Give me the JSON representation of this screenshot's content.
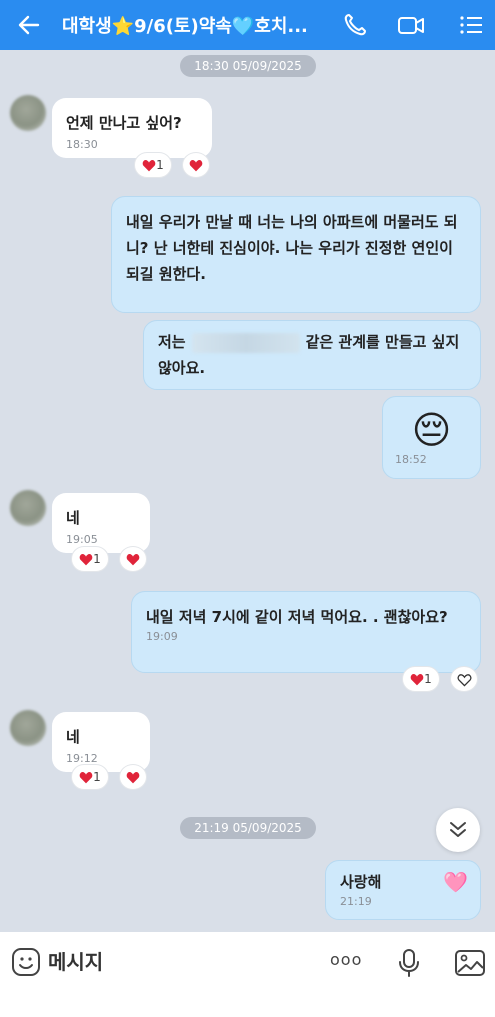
{
  "header": {
    "title": "대학생⭐9/6(토)약속🩵호치...",
    "accent": "#2a8cf0"
  },
  "dates": {
    "first": "18:30 05/09/2025",
    "second": "21:19 05/09/2025"
  },
  "messages": [
    {
      "side": "in",
      "text": "언제 만나고 싶어?",
      "time": "18:30",
      "reaction_count": "1"
    },
    {
      "side": "out",
      "text": "내일 우리가 만날 때 너는 나의 아파트에 머물러도 되니? 난 너한테 진심이야. 나는 우리가 진정한 연인이 되길 원한다."
    },
    {
      "side": "out",
      "text_before": "저는",
      "text_after": "같은 관계를 만들고 싶지 않아요."
    },
    {
      "side": "out",
      "emoji": "😔",
      "time": "18:52"
    },
    {
      "side": "in",
      "text": "네",
      "time": "19:05",
      "reaction_count": "1"
    },
    {
      "side": "out",
      "text": "내일 저녁 7시에 같이 저녁 먹어요. . 괜찮아요?",
      "time": "19:09",
      "reaction_count": "1"
    },
    {
      "side": "in",
      "text": "네",
      "time": "19:12",
      "reaction_count": "1"
    },
    {
      "side": "out",
      "text": "사랑해",
      "emoji": "🩷",
      "time": "21:19"
    }
  ],
  "input": {
    "placeholder": "메시지",
    "more_label": "ooo"
  },
  "icons": [
    "back-arrow-icon",
    "phone-icon",
    "video-call-icon",
    "menu-icon",
    "heart-icon",
    "heart-outline-icon",
    "chevron-double-down-icon",
    "smile-icon",
    "microphone-icon",
    "image-icon"
  ],
  "colors": {
    "incoming": "#ffffff",
    "outgoing": "#cfe9fb",
    "background": "#d9dfe8",
    "heart": "#e0243a"
  }
}
